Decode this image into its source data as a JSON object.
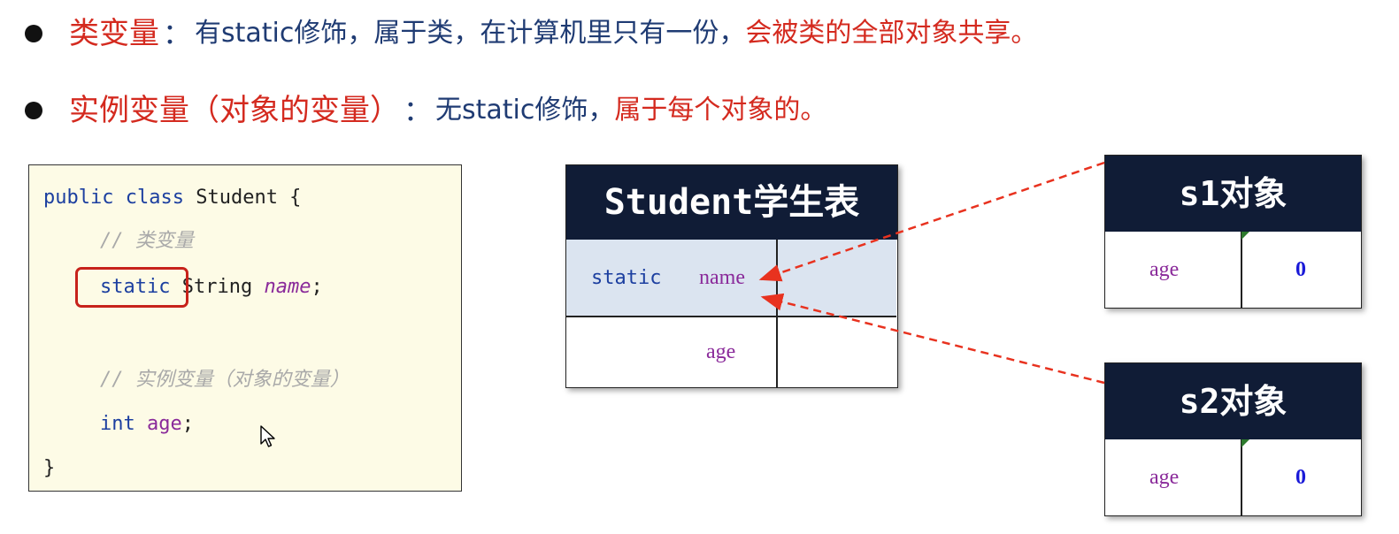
{
  "bullets": [
    {
      "term": "类变量",
      "colon": "：",
      "desc_blue": "有static修饰，属于类，在计算机里只有一份，",
      "desc_red": "会被类的全部对象共享。"
    },
    {
      "term": "实例变量（对象的变量）",
      "colon": "：",
      "desc_blue": "无static修饰，",
      "desc_red": "属于每个对象的。"
    }
  ],
  "code": {
    "line1_kw1": "public",
    "line1_kw2": "class",
    "line1_name": "Student {",
    "comment1": "// 类变量",
    "static_kw": "static",
    "string_type": "String",
    "name_field": "name",
    "semi": ";",
    "comment2": "// 实例变量（对象的变量）",
    "int_kw": "int",
    "age_field": "age",
    "closing": "}"
  },
  "class_table": {
    "title": "Student学生表",
    "row1_static": "static",
    "row1_name": "name",
    "row2_age": "age"
  },
  "objects": [
    {
      "title": "s1对象",
      "field": "age",
      "value": "0"
    },
    {
      "title": "s2对象",
      "field": "age",
      "value": "0"
    }
  ],
  "colors": {
    "accent_red": "#d42a1f",
    "text_blue": "#1f3b73",
    "table_header_navy": "#101c36",
    "static_row_bg": "#dbe4f0",
    "code_bg": "#fdfbe6",
    "value_blue": "#1a1ad8",
    "field_purple": "#8a2a9a"
  },
  "icons": [
    "bullet-dot",
    "mouse-cursor-icon",
    "dashed-arrow"
  ]
}
